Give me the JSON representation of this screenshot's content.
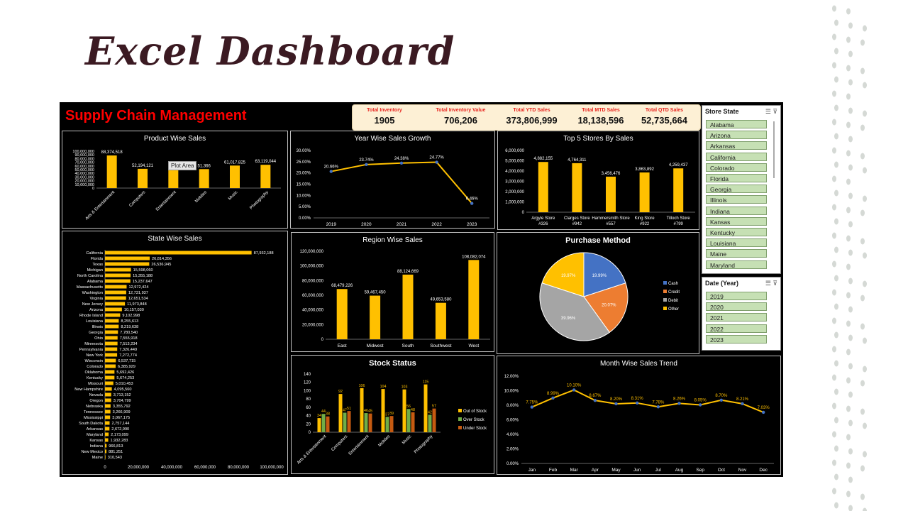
{
  "slide": {
    "title": "Excel Dashboard"
  },
  "header": {
    "title": "Supply Chain Management"
  },
  "kpis": [
    {
      "label": "Total Inventory",
      "value": "1905"
    },
    {
      "label": "Total Inventory Value",
      "value": "706,206"
    },
    {
      "label": "Total YTD Sales",
      "value": "373,806,999"
    },
    {
      "label": "Total MTD Sales",
      "value": "18,138,596"
    },
    {
      "label": "Total QTD Sales",
      "value": "52,735,664"
    }
  ],
  "colors": {
    "bar": "#ffc000",
    "line": "#ffc000",
    "marker": "#4472c4",
    "label": "#ffc000",
    "slicer": "#c6e0b4"
  },
  "slicers": {
    "state": {
      "title": "Store State",
      "items": [
        "Alabama",
        "Arizona",
        "Arkansas",
        "California",
        "Colorado",
        "Florida",
        "Georgia",
        "Illinois",
        "Indiana",
        "Kansas",
        "Kentucky",
        "Louisiana",
        "Maine",
        "Maryland"
      ]
    },
    "year": {
      "title": "Date (Year)",
      "items": [
        "2019",
        "2020",
        "2021",
        "2022",
        "2023"
      ]
    }
  },
  "tooltip": {
    "plot_area": "Plot Area"
  },
  "chart_data": [
    {
      "id": "product",
      "type": "bar",
      "title": "Product Wise Sales",
      "categories": [
        "Arts & Entertainment",
        "Computers",
        "Entertainment",
        "Mobiles",
        "Music",
        "Photography"
      ],
      "values": [
        88374518,
        52194121,
        57000000,
        51366000,
        61017825,
        63119044
      ],
      "data_labels": [
        "88,374,518",
        "52,194,121",
        "57,",
        "51,366",
        "61,017,825",
        "63,119,044"
      ],
      "y_ticks": [
        "100,000,000",
        "90,000,000",
        "80,000,000",
        "70,000,000",
        "60,000,000",
        "50,000,000",
        "40,000,000",
        "30,000,000",
        "20,000,000",
        "10,000,000",
        "0"
      ],
      "ylim": [
        0,
        100000000
      ]
    },
    {
      "id": "yoy",
      "type": "line",
      "title": "Year Wise Sales Growth",
      "categories": [
        "2019",
        "2020",
        "2021",
        "2022",
        "2023"
      ],
      "values": [
        20.66,
        23.74,
        24.38,
        24.77,
        6.46
      ],
      "data_labels": [
        "20.66%",
        "23.74%",
        "24.38%",
        "24.77%",
        "6.46%"
      ],
      "y_ticks": [
        "30.00%",
        "25.00%",
        "20.00%",
        "15.00%",
        "10.00%",
        "5.00%",
        "0.00%"
      ],
      "ylim": [
        0,
        30
      ]
    },
    {
      "id": "stores",
      "type": "bar",
      "title": "Top 5  Stores By Sales",
      "categories": [
        "Argyle Store #326",
        "Clarges Store #942",
        "Hammersmith Store #557",
        "King Store #922",
        "Tilloch Store #799"
      ],
      "values": [
        4882155,
        4764311,
        3456476,
        3863892,
        4259437
      ],
      "data_labels": [
        "4,882,155",
        "4,764,311",
        "3,456,476",
        "3,863,892",
        "4,259,437"
      ],
      "y_ticks": [
        "6,000,000",
        "5,000,000",
        "4,000,000",
        "3,000,000",
        "2,000,000",
        "1,000,000",
        "0"
      ],
      "ylim": [
        0,
        6000000
      ]
    },
    {
      "id": "state",
      "type": "bar",
      "title": "State Wise Sales",
      "categories": [
        "California",
        "Florida",
        "Texas",
        "Michigan",
        "North Carolina",
        "Alabama",
        "Massachusetts",
        "Washington",
        "Virginia",
        "New Jersey",
        "Arizona",
        "Rhode Island",
        "Louisiana",
        "Illinois",
        "Georgia",
        "Ohio",
        "Minnesota",
        "Pennsylvania",
        "New York",
        "Wisconsin",
        "Colorado",
        "Oklahoma",
        "Kentucky",
        "Missouri",
        "New Hampshire",
        "Nevada",
        "Oregon",
        "Nebraska",
        "Tennessee",
        "Mississippi",
        "South Dakota",
        "Arkansas",
        "Maryland",
        "Kansas",
        "Indiana",
        "New Mexico",
        "Maine"
      ],
      "values": [
        87932188,
        26814356,
        26536945,
        15598060,
        15355188,
        15237647,
        12972424,
        12731937,
        12651534,
        11973848,
        10157030,
        9102998,
        8255613,
        8219638,
        7780540,
        7555918,
        7513234,
        7326449,
        7272774,
        6537715,
        6385929,
        5692426,
        5674253,
        5010453,
        4095560,
        3713152,
        3704799,
        3355792,
        3266909,
        3067175,
        2757144,
        2672990,
        2173099,
        1932283,
        966813,
        881251,
        310543
      ],
      "data_labels": [
        "87,932,188",
        "26,814,356",
        "26,536,945",
        "15,598,060",
        "15,355,188",
        "15,237,647",
        "12,972,424",
        "12,731,937",
        "12,651,534",
        "11,973,848",
        "10,157,030",
        "9,102,998",
        "8,255,613",
        "8,219,638",
        "7,780,540",
        "7,555,918",
        "7,513,234",
        "7,326,449",
        "7,272,774",
        "6,537,715",
        "6,385,929",
        "5,692,426",
        "5,674,253",
        "5,010,453",
        "4,095,560",
        "3,713,152",
        "3,704,799",
        "3,355,792",
        "3,266,909",
        "3,067,175",
        "2,757,144",
        "2,672,990",
        "2,173,099",
        "1,932,283",
        "966,813",
        "881,251",
        "310,543"
      ],
      "x_ticks": [
        "0",
        "20,000,000",
        "40,000,000",
        "60,000,000",
        "80,000,000",
        "100,000,000"
      ],
      "xlim": [
        0,
        100000000
      ]
    },
    {
      "id": "region",
      "type": "bar",
      "title": "Region Wise Sales",
      "categories": [
        "East",
        "Midwest",
        "South",
        "Southwest",
        "West"
      ],
      "values": [
        68479226,
        59467450,
        88124669,
        49653580,
        108082074
      ],
      "data_labels": [
        "68,479,226",
        "59,467,450",
        "88,124,669",
        "49,653,580",
        "108,082,074"
      ],
      "y_ticks": [
        "120,000,000",
        "100,000,000",
        "80,000,000",
        "60,000,000",
        "40,000,000",
        "20,000,000",
        "0"
      ],
      "ylim": [
        0,
        120000000
      ]
    },
    {
      "id": "purchase",
      "type": "pie",
      "title": "Purchase Method",
      "categories": [
        "Cash",
        "Credit",
        "Debit",
        "Other"
      ],
      "values": [
        19.99,
        20.07,
        39.96,
        19.97
      ],
      "data_labels": [
        "19.99%",
        "20.07%",
        "39.96%",
        "19.97%"
      ],
      "colors": [
        "#4472c4",
        "#ed7d31",
        "#a5a5a5",
        "#ffc000"
      ],
      "legend": "right"
    },
    {
      "id": "stock",
      "type": "bar",
      "title": "Stock Status",
      "categories": [
        "Arts & Entertainment",
        "Computers",
        "Entertainment",
        "Mobiles",
        "Music",
        "Photography"
      ],
      "series": [
        {
          "name": "Out of Stock",
          "values": [
            34,
            92,
            106,
            104,
            103,
            115
          ],
          "color": "#ffc000"
        },
        {
          "name": "Over Stock",
          "values": [
            44,
            47,
            46,
            37,
            56,
            42
          ],
          "color": "#70ad47"
        },
        {
          "name": "Under Stock",
          "values": [
            38,
            51,
            45,
            39,
            48,
            57
          ],
          "color": "#c55a11"
        }
      ],
      "y_ticks": [
        "140",
        "120",
        "100",
        "80",
        "60",
        "40",
        "20",
        "0"
      ],
      "ylim": [
        0,
        140
      ],
      "legend": "right"
    },
    {
      "id": "month",
      "type": "line",
      "title": "Month Wise Sales Trend",
      "categories": [
        "Jan",
        "Feb",
        "Mar",
        "Apr",
        "May",
        "Jun",
        "Jul",
        "Aug",
        "Sep",
        "Oct",
        "Nov",
        "Dec"
      ],
      "values": [
        7.75,
        8.99,
        10.1,
        8.67,
        8.2,
        8.31,
        7.78,
        8.26,
        8.05,
        8.7,
        8.21,
        7.03
      ],
      "data_labels": [
        "7.75%",
        "8.99%",
        "10.10%",
        "8.67%",
        "8.20%",
        "8.31%",
        "7.78%",
        "8.26%",
        "8.05%",
        "8.70%",
        "8.21%",
        "7.03%"
      ],
      "y_ticks": [
        "12.00%",
        "10.00%",
        "8.00%",
        "6.00%",
        "4.00%",
        "2.00%",
        "0.00%"
      ],
      "ylim": [
        0,
        12
      ]
    }
  ]
}
